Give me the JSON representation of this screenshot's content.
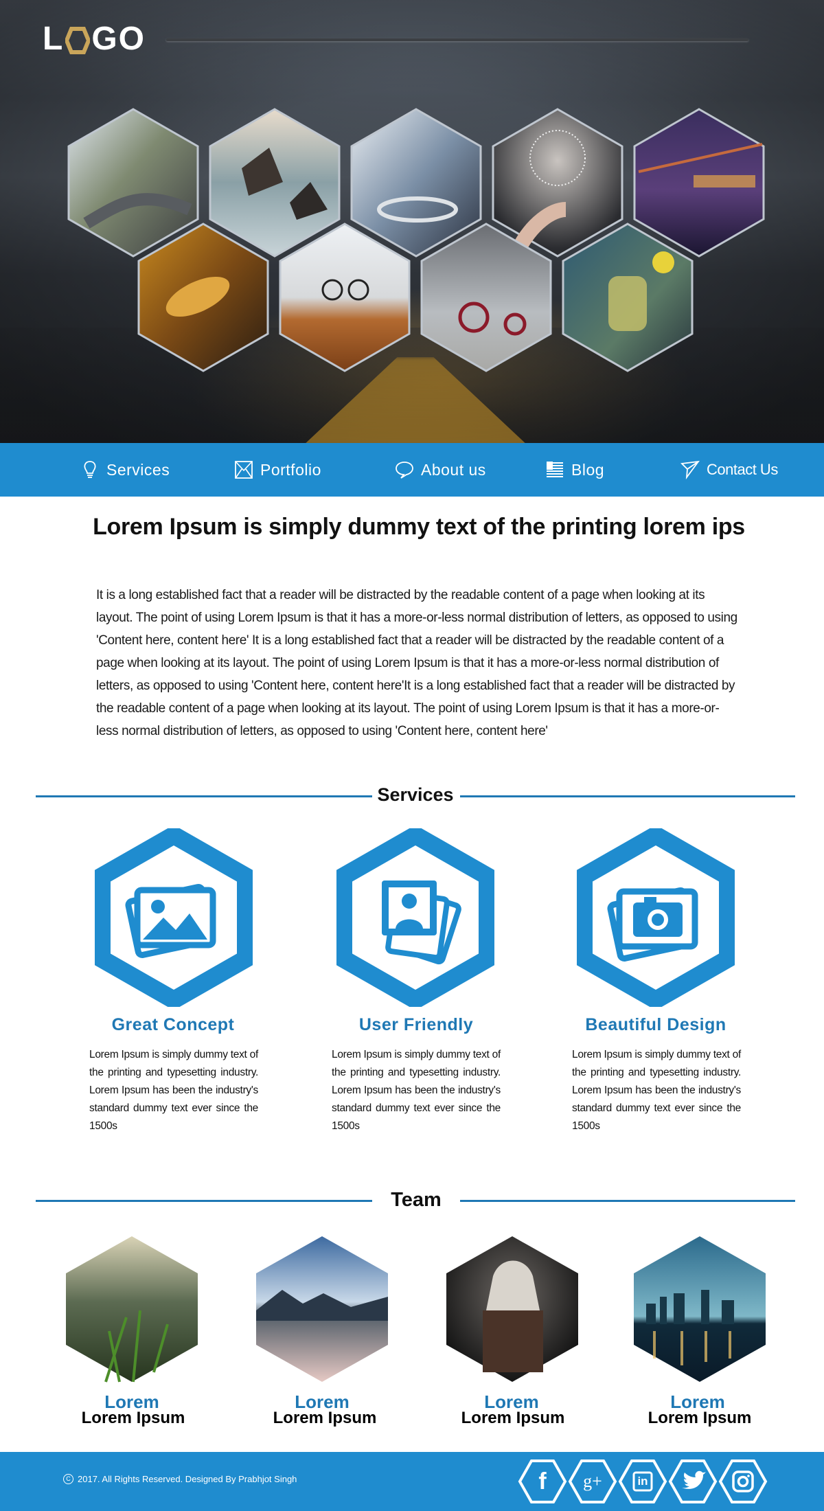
{
  "header": {
    "logo_text_start": "L",
    "logo_text_end": "GO",
    "logo_letter_o_color": "#c9a55a"
  },
  "hero": {
    "gallery": [
      {
        "subject": "mountain road"
      },
      {
        "subject": "sea rocks"
      },
      {
        "subject": "coffee cup"
      },
      {
        "subject": "dandelion"
      },
      {
        "subject": "city bridge at night"
      },
      {
        "subject": "autumn leaves"
      },
      {
        "subject": "desk with glasses"
      },
      {
        "subject": "tricycle"
      },
      {
        "subject": "tea press"
      }
    ]
  },
  "nav": {
    "items": [
      {
        "label": "Services",
        "icon": "lightbulb-icon"
      },
      {
        "label": "Portfolio",
        "icon": "envelope-icon"
      },
      {
        "label": "About us",
        "icon": "chat-bubble-icon"
      },
      {
        "label": "Blog",
        "icon": "document-lines-icon"
      },
      {
        "label": "Contact Us",
        "icon": "paper-plane-icon"
      }
    ]
  },
  "intro": {
    "headline": "Lorem Ipsum is simply dummy text of the printing lorem ips",
    "paragraph": "It is a long established fact that a reader will be distracted by the readable content of a page when looking at its layout. The point of using Lorem Ipsum is that it has a more-or-less normal distribution of letters, as opposed to using 'Content here, content here' It is a long established fact that a reader will be distracted by the readable content of a page when looking at its layout. The point of using Lorem Ipsum is that it has a more-or-less normal distribution of letters, as opposed to using 'Content here, content here'It is a long established fact that a reader will be distracted by the readable content of a page when looking at its layout. The point of using Lorem Ipsum is that it has a more-or-less normal distribution of letters, as opposed to using 'Content here, content here'"
  },
  "services": {
    "title": "Services",
    "items": [
      {
        "icon": "landscape-photos-icon",
        "title": "Great Concept",
        "text": "Lorem Ipsum is simply dummy text of the printing and typesetting industry. Lorem Ipsum has been the industry's standard dummy text ever since the 1500s"
      },
      {
        "icon": "portrait-photos-icon",
        "title": "User Friendly",
        "text": "Lorem Ipsum is simply dummy text of the printing and typesetting industry. Lorem Ipsum has been the industry's standard dummy text ever since the 1500s"
      },
      {
        "icon": "camera-photos-icon",
        "title": "Beautiful Design",
        "text": "Lorem Ipsum is simply dummy text of the printing and typesetting industry. Lorem Ipsum has been the industry's standard dummy text ever since the 1500s"
      }
    ]
  },
  "team": {
    "title": "Team",
    "members": [
      {
        "role": "Lorem",
        "name": "Lorem Ipsum",
        "photo": "grass close-up"
      },
      {
        "role": "Lorem",
        "name": "Lorem Ipsum",
        "photo": "lake island"
      },
      {
        "role": "Lorem",
        "name": "Lorem Ipsum",
        "photo": "hooded warrior"
      },
      {
        "role": "Lorem",
        "name": "Lorem Ipsum",
        "photo": "city skyline"
      }
    ]
  },
  "footer": {
    "copyright_symbol": "C",
    "copyright": "2017. All Rights Reserved. Designed By Prabhjot Singh",
    "social": [
      {
        "icon": "facebook-icon",
        "glyph": "f"
      },
      {
        "icon": "google-plus-icon",
        "glyph": "g+"
      },
      {
        "icon": "linkedin-icon",
        "glyph": "in"
      },
      {
        "icon": "twitter-icon",
        "glyph": ""
      },
      {
        "icon": "instagram-icon",
        "glyph": ""
      }
    ]
  },
  "colors": {
    "brand_blue": "#1f8ccf",
    "heading_blue": "#1f78b4",
    "logo_gold": "#c9a55a"
  }
}
